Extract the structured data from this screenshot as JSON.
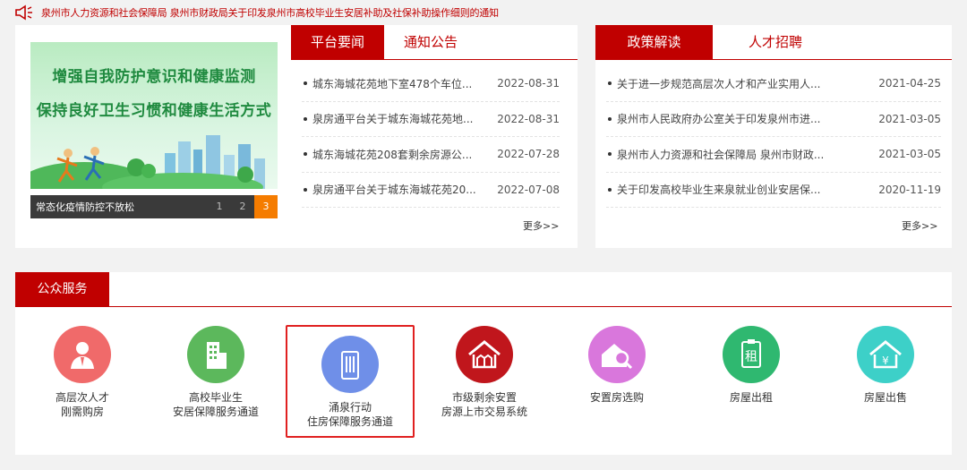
{
  "notice": {
    "text": "泉州市人力资源和社会保障局 泉州市财政局关于印发泉州市高校毕业生安居补助及社保补助操作细则的通知"
  },
  "carousel": {
    "banner_line1": "增强自我防护意识和健康监测",
    "banner_line2": "保持良好卫生习惯和健康生活方式",
    "caption": "常态化疫情防控不放松",
    "pages": [
      "1",
      "2",
      "3"
    ],
    "active_page": "3"
  },
  "left_tabs": [
    {
      "label": "平台要闻",
      "active": true
    },
    {
      "label": "通知公告",
      "active": false
    }
  ],
  "left_news": [
    {
      "title": "城东海城花苑地下室478个车位...",
      "date": "2022-08-31"
    },
    {
      "title": "泉房通平台关于城东海城花苑地...",
      "date": "2022-08-31"
    },
    {
      "title": "城东海城花苑208套剩余房源公...",
      "date": "2022-07-28"
    },
    {
      "title": "泉房通平台关于城东海城花苑20...",
      "date": "2022-07-08"
    }
  ],
  "left_more": "更多>>",
  "right_tabs": [
    {
      "label": "政策解读",
      "active": true
    },
    {
      "label": "人才招聘",
      "active": false
    }
  ],
  "right_news": [
    {
      "title": "关于进一步规范高层次人才和产业实用人...",
      "date": "2021-04-25"
    },
    {
      "title": "泉州市人民政府办公室关于印发泉州市进...",
      "date": "2021-03-05"
    },
    {
      "title": "泉州市人力资源和社会保障局 泉州市财政...",
      "date": "2021-03-05"
    },
    {
      "title": "关于印发高校毕业生来泉就业创业安居保...",
      "date": "2020-11-19"
    }
  ],
  "right_more": "更多>>",
  "services": {
    "title": "公众服务",
    "items": [
      {
        "line1": "高层次人才",
        "line2": "刚需购房",
        "color": "#f06a6a",
        "icon": "person-icon"
      },
      {
        "line1": "高校毕业生",
        "line2": "安居保障服务通道",
        "color": "#5cb85c",
        "icon": "building-icon"
      },
      {
        "line1": "涌泉行动",
        "line2": "住房保障服务通道",
        "color": "#6f8fe8",
        "icon": "tower-icon"
      },
      {
        "line1": "市级剩余安置",
        "line2": "房源上市交易系统",
        "color": "#c0161c",
        "icon": "houses-icon"
      },
      {
        "line1": "安置房选购",
        "line2": "",
        "color": "#d977dc",
        "icon": "house-search-icon"
      },
      {
        "line1": "房屋出租",
        "line2": "",
        "color": "#2fb870",
        "icon": "rent-icon"
      },
      {
        "line1": "房屋出售",
        "line2": "",
        "color": "#3dd0c8",
        "icon": "sale-icon"
      }
    ]
  },
  "colors": {
    "brand": "#c00000",
    "accent": "#f57c00"
  }
}
